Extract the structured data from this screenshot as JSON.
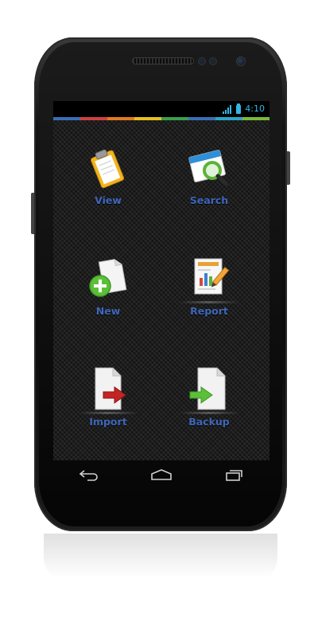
{
  "statusbar": {
    "time": "4:10",
    "accent_color": "#33b5e5",
    "signal_label": "H"
  },
  "color_strip": [
    "#3a6fb5",
    "#d04040",
    "#e07a20",
    "#e6c020",
    "#3aa04a",
    "#3a6fb5",
    "#2aa5c8",
    "#7ab83a"
  ],
  "menu": {
    "label_color": "#3f66b8",
    "items": [
      {
        "label": "View",
        "icon": "clipboard-icon"
      },
      {
        "label": "Search",
        "icon": "search-window-icon"
      },
      {
        "label": "New",
        "icon": "new-document-icon"
      },
      {
        "label": "Report",
        "icon": "report-icon"
      },
      {
        "label": "Import",
        "icon": "import-icon"
      },
      {
        "label": "Backup",
        "icon": "backup-icon"
      }
    ]
  },
  "navbar": {
    "buttons": [
      "back-icon",
      "home-icon",
      "recent-apps-icon"
    ]
  }
}
